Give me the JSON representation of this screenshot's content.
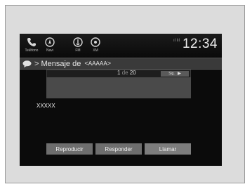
{
  "statusbar": {
    "buttons": [
      {
        "label": "Teléfono",
        "icon": "phone-icon"
      },
      {
        "label": "Navi",
        "icon": "navi-icon"
      },
      {
        "label": "FM",
        "icon": "fm-icon"
      },
      {
        "label": "XM",
        "icon": "xm-icon"
      }
    ],
    "clock": "12:34"
  },
  "header": {
    "title": "Mensaje de",
    "sender": "<AAAAA>"
  },
  "pager": {
    "current": "1",
    "separator": "de",
    "total": "20",
    "next_label": "Sig."
  },
  "message": {
    "body": "XXXXX"
  },
  "actions": [
    {
      "label": "Reproducir"
    },
    {
      "label": "Responder"
    },
    {
      "label": "Llamar"
    }
  ]
}
